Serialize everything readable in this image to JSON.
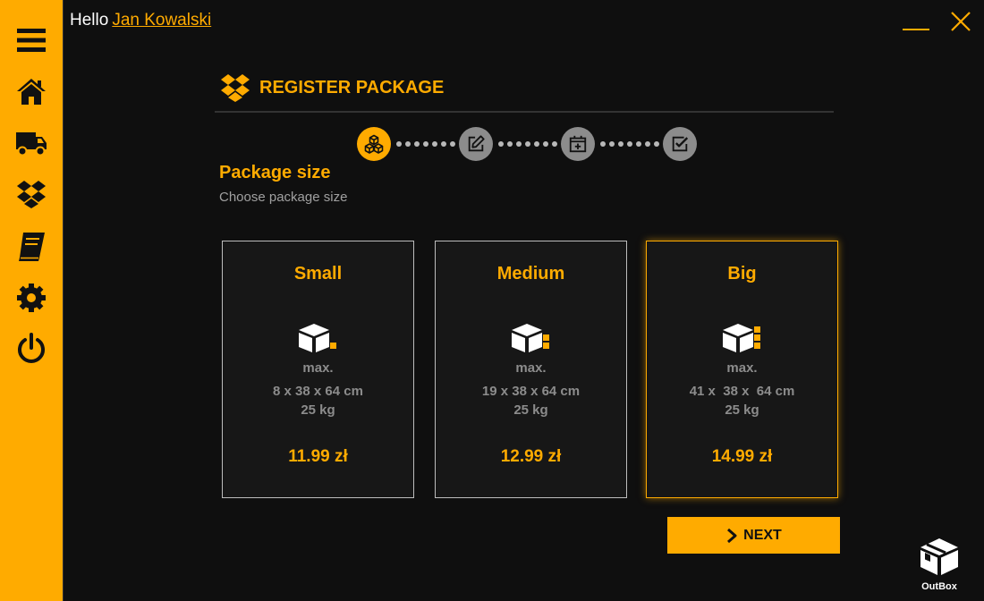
{
  "header": {
    "greeting": "Hello",
    "user_name": "Jan Kowalski"
  },
  "sidebar": {
    "items": [
      {
        "icon": "menu-icon"
      },
      {
        "icon": "home-icon"
      },
      {
        "icon": "truck-icon"
      },
      {
        "icon": "dropbox-icon"
      },
      {
        "icon": "book-icon"
      },
      {
        "icon": "gear-icon"
      },
      {
        "icon": "power-icon"
      }
    ]
  },
  "page": {
    "title": "REGISTER PACKAGE",
    "section_title": "Package size",
    "section_subtitle": "Choose package size"
  },
  "steps": [
    {
      "icon": "cubes-icon",
      "state": "active"
    },
    {
      "icon": "edit-icon",
      "state": "inactive"
    },
    {
      "icon": "calendar-plus-icon",
      "state": "inactive"
    },
    {
      "icon": "check-square-icon",
      "state": "inactive"
    }
  ],
  "packages": [
    {
      "name": "Small",
      "max_label": "max.",
      "dims": "8 x 38 x 64 cm",
      "weight": "25 kg",
      "price": "11.99 zł",
      "selected": false
    },
    {
      "name": "Medium",
      "max_label": "max.",
      "dims": "19 x 38 x 64 cm",
      "weight": "25 kg",
      "price": "12.99 zł",
      "selected": false
    },
    {
      "name": "Big",
      "max_label": "max.",
      "dims": "41 x  38 x  64 cm",
      "weight": "25 kg",
      "price": "14.99 zł",
      "selected": true
    }
  ],
  "actions": {
    "next_label": "NEXT"
  },
  "logo": {
    "text": "OutBox"
  },
  "colors": {
    "accent": "#ffab00",
    "background": "#0f0f0f",
    "card_background": "#171717",
    "muted_text": "#8c8c8c"
  }
}
